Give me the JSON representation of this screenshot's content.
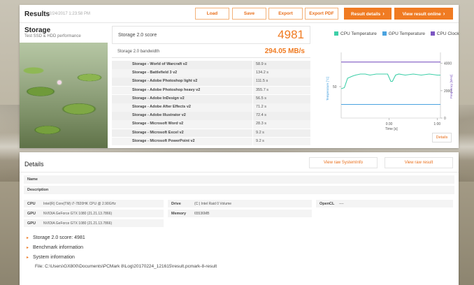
{
  "header": {
    "title": "Results",
    "date": "2/24/2017 1:23:58 PM",
    "buttons": {
      "load": "Load",
      "save": "Save",
      "export": "Export",
      "export_pdf": "Export PDF",
      "result_details": "Result details",
      "view_online": "View result online"
    }
  },
  "storage": {
    "title": "Storage",
    "subtitle": "Test SSD & HDD performance",
    "score_label": "Storage 2.0 score",
    "score_value": "4981",
    "bandwidth_label": "Storage 2.0 bandwidth",
    "bandwidth_value": "294.05 MB/s",
    "subtests": [
      {
        "name": "Storage - World of Warcraft v2",
        "value": "58.9 s"
      },
      {
        "name": "Storage - Battlefield 3 v2",
        "value": "134.2 s"
      },
      {
        "name": "Storage - Adobe Photoshop light v2",
        "value": "111.5 s"
      },
      {
        "name": "Storage - Adobe Photoshop heavy v2",
        "value": "355.7 s"
      },
      {
        "name": "Storage - Adobe InDesign v2",
        "value": "56.5 s"
      },
      {
        "name": "Storage - Adobe After Effects v2",
        "value": "71.2 s"
      },
      {
        "name": "Storage - Adobe Illustrator v2",
        "value": "72.4 s"
      },
      {
        "name": "Storage - Microsoft Word v2",
        "value": "28.3 s"
      },
      {
        "name": "Storage - Microsoft Excel v2",
        "value": "9.2 s"
      },
      {
        "name": "Storage - Microsoft PowerPoint v2",
        "value": "9.2 s"
      }
    ]
  },
  "chart_data": {
    "type": "line",
    "legend": [
      "CPU Temperature",
      "GPU Temperature",
      "CPU Clock"
    ],
    "colors": {
      "cpu_temp": "#3ecfa8",
      "gpu_temp": "#4ba3e0",
      "cpu_clock": "#7d57c2"
    },
    "ylabel_left": "Temperature [°C]",
    "ylabel_right": "Frequency [MHz]",
    "xlabel": "Time [s]",
    "x_ticks": [
      "0:30",
      "1:00"
    ],
    "y_left_ticks": [
      "50"
    ],
    "y_right_ticks": [
      "0",
      "2000",
      "4000"
    ],
    "x_range": [
      0,
      62
    ],
    "y_left_range": [
      20,
      80
    ],
    "y_right_range": [
      0,
      4600
    ],
    "series": [
      {
        "name": "CPU Temperature",
        "x": [
          0,
          2,
          4,
          7,
          9,
          12,
          15,
          18,
          22,
          26,
          29,
          31,
          32,
          34,
          36,
          40,
          45,
          50,
          55,
          60,
          62
        ],
        "y": [
          48,
          49,
          58,
          60,
          61,
          62,
          62,
          61,
          62,
          62,
          62,
          55,
          55,
          61,
          62,
          61,
          62,
          61,
          62,
          61,
          61
        ]
      },
      {
        "name": "GPU Temperature",
        "x": [
          0,
          62
        ],
        "y": [
          33,
          33
        ]
      },
      {
        "name": "CPU Clock",
        "x": [
          0,
          62
        ],
        "y": [
          4100,
          4100
        ]
      }
    ]
  },
  "details_button": "Details",
  "details": {
    "title": "Details",
    "view_systeminfo": "View raw SystemInfo",
    "view_result": "View raw result",
    "name_label": "Name",
    "name_value": "",
    "description_label": "Description",
    "description_value": "",
    "hardware": [
      {
        "key": "CPU",
        "value": "Intel(R) Core(TM) i7-7820HK CPU @ 2.90GHz"
      },
      {
        "key": "GPU",
        "value": "NVIDIA GeForce GTX 1080 (21.21.13.7866)"
      },
      {
        "key": "GPU",
        "value": "NVIDIA GeForce GTX 1080 (21.21.13.7866)"
      }
    ],
    "drive_label": "Drive",
    "drive_value": "(C:) Intel Raid 0 Volume",
    "memory_label": "Memory",
    "memory_value": "65536MB",
    "opencl_label": "OpenCL",
    "opencl_value": "----",
    "expanders": [
      "Storage 2.0 score: 4981",
      "Benchmark information",
      "System information"
    ],
    "file_path": "File: C:\\Users\\GX800\\Documents\\PCMark 8\\Log\\20170224_121615\\result.pcmark-8-result"
  }
}
